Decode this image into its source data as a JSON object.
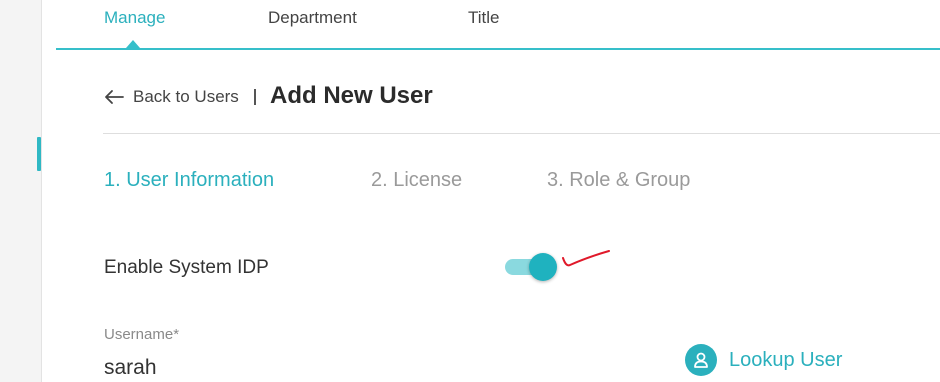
{
  "nav": {
    "tabs": [
      {
        "label": "Manage",
        "active": true
      },
      {
        "label": "Department",
        "active": false
      },
      {
        "label": "Title",
        "active": false
      }
    ]
  },
  "header": {
    "back_label": "Back to Users",
    "title": "Add New User"
  },
  "steps": [
    {
      "label": "1. User Information",
      "active": true
    },
    {
      "label": "2. License",
      "active": false
    },
    {
      "label": "3. Role & Group",
      "active": false
    }
  ],
  "form": {
    "idp_label": "Enable System IDP",
    "idp_enabled": true,
    "username_label": "Username*",
    "username_value": "sarah",
    "lookup_label": "Lookup User"
  },
  "icons": {
    "back": "arrow-left-icon",
    "lookup": "user-icon",
    "annotation": "checkmark-icon"
  },
  "colors": {
    "accent": "#2bb0bd",
    "toggle_track": "#8ad9df",
    "annotation": "#e0192a"
  }
}
